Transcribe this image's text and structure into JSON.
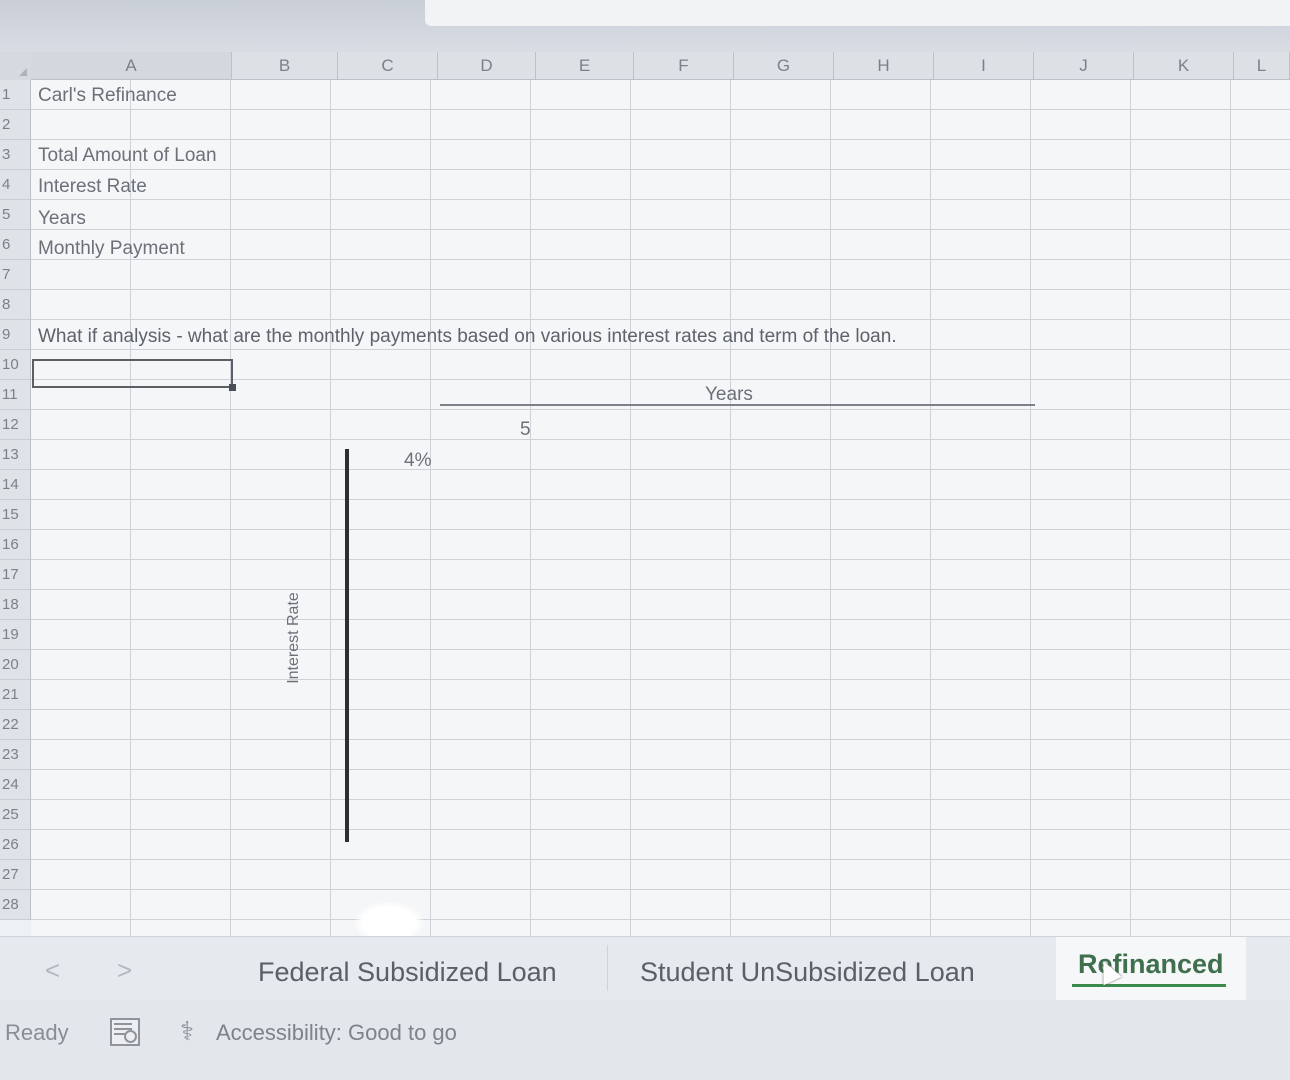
{
  "columns": [
    "A",
    "B",
    "C",
    "D",
    "E",
    "F",
    "G",
    "H",
    "I",
    "J",
    "K",
    "L"
  ],
  "rows": [
    "1",
    "2",
    "3",
    "4",
    "5",
    "6",
    "7",
    "8",
    "9",
    "10",
    "11",
    "12",
    "13",
    "14",
    "15",
    "16",
    "17",
    "18",
    "19",
    "20",
    "21",
    "22",
    "23",
    "24",
    "25",
    "26",
    "27",
    "28"
  ],
  "cells": {
    "A1": "Carl's Refinance",
    "A3": "Total Amount of Loan",
    "A4": "Interest Rate",
    "A5": "Years",
    "A6": "Monthly Payment",
    "A9": "What if analysis - what are the monthly payments based on various interest rates and term of the loan.",
    "years_header": "Years",
    "D12": "5",
    "C13": "4%",
    "interest_rate_label": "Interest Rate"
  },
  "sheet_tabs": [
    {
      "label": "Federal Subsidized Loan",
      "active": false
    },
    {
      "label": "Student UnSubsidized Loan",
      "active": false
    },
    {
      "label": "Refinanced",
      "active": true
    }
  ],
  "nav": {
    "prev": "<",
    "next": ">"
  },
  "status": {
    "ready": "Ready",
    "accessibility": "Accessibility: Good to go"
  },
  "icons": {
    "macro": "macro-record-icon",
    "accessibility": "accessibility-icon",
    "cursor": "mouse-pointer-icon"
  },
  "colors": {
    "active_tab_underline": "#3b8a4e",
    "grid_line": "#cdd2d8"
  }
}
